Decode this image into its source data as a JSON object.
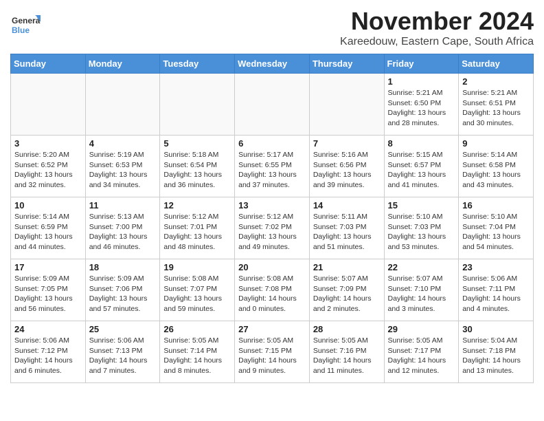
{
  "header": {
    "logo_general": "General",
    "logo_blue": "Blue",
    "month_title": "November 2024",
    "location": "Kareedouw, Eastern Cape, South Africa"
  },
  "weekdays": [
    "Sunday",
    "Monday",
    "Tuesday",
    "Wednesday",
    "Thursday",
    "Friday",
    "Saturday"
  ],
  "weeks": [
    [
      {
        "day": "",
        "info": ""
      },
      {
        "day": "",
        "info": ""
      },
      {
        "day": "",
        "info": ""
      },
      {
        "day": "",
        "info": ""
      },
      {
        "day": "",
        "info": ""
      },
      {
        "day": "1",
        "info": "Sunrise: 5:21 AM\nSunset: 6:50 PM\nDaylight: 13 hours\nand 28 minutes."
      },
      {
        "day": "2",
        "info": "Sunrise: 5:21 AM\nSunset: 6:51 PM\nDaylight: 13 hours\nand 30 minutes."
      }
    ],
    [
      {
        "day": "3",
        "info": "Sunrise: 5:20 AM\nSunset: 6:52 PM\nDaylight: 13 hours\nand 32 minutes."
      },
      {
        "day": "4",
        "info": "Sunrise: 5:19 AM\nSunset: 6:53 PM\nDaylight: 13 hours\nand 34 minutes."
      },
      {
        "day": "5",
        "info": "Sunrise: 5:18 AM\nSunset: 6:54 PM\nDaylight: 13 hours\nand 36 minutes."
      },
      {
        "day": "6",
        "info": "Sunrise: 5:17 AM\nSunset: 6:55 PM\nDaylight: 13 hours\nand 37 minutes."
      },
      {
        "day": "7",
        "info": "Sunrise: 5:16 AM\nSunset: 6:56 PM\nDaylight: 13 hours\nand 39 minutes."
      },
      {
        "day": "8",
        "info": "Sunrise: 5:15 AM\nSunset: 6:57 PM\nDaylight: 13 hours\nand 41 minutes."
      },
      {
        "day": "9",
        "info": "Sunrise: 5:14 AM\nSunset: 6:58 PM\nDaylight: 13 hours\nand 43 minutes."
      }
    ],
    [
      {
        "day": "10",
        "info": "Sunrise: 5:14 AM\nSunset: 6:59 PM\nDaylight: 13 hours\nand 44 minutes."
      },
      {
        "day": "11",
        "info": "Sunrise: 5:13 AM\nSunset: 7:00 PM\nDaylight: 13 hours\nand 46 minutes."
      },
      {
        "day": "12",
        "info": "Sunrise: 5:12 AM\nSunset: 7:01 PM\nDaylight: 13 hours\nand 48 minutes."
      },
      {
        "day": "13",
        "info": "Sunrise: 5:12 AM\nSunset: 7:02 PM\nDaylight: 13 hours\nand 49 minutes."
      },
      {
        "day": "14",
        "info": "Sunrise: 5:11 AM\nSunset: 7:03 PM\nDaylight: 13 hours\nand 51 minutes."
      },
      {
        "day": "15",
        "info": "Sunrise: 5:10 AM\nSunset: 7:03 PM\nDaylight: 13 hours\nand 53 minutes."
      },
      {
        "day": "16",
        "info": "Sunrise: 5:10 AM\nSunset: 7:04 PM\nDaylight: 13 hours\nand 54 minutes."
      }
    ],
    [
      {
        "day": "17",
        "info": "Sunrise: 5:09 AM\nSunset: 7:05 PM\nDaylight: 13 hours\nand 56 minutes."
      },
      {
        "day": "18",
        "info": "Sunrise: 5:09 AM\nSunset: 7:06 PM\nDaylight: 13 hours\nand 57 minutes."
      },
      {
        "day": "19",
        "info": "Sunrise: 5:08 AM\nSunset: 7:07 PM\nDaylight: 13 hours\nand 59 minutes."
      },
      {
        "day": "20",
        "info": "Sunrise: 5:08 AM\nSunset: 7:08 PM\nDaylight: 14 hours\nand 0 minutes."
      },
      {
        "day": "21",
        "info": "Sunrise: 5:07 AM\nSunset: 7:09 PM\nDaylight: 14 hours\nand 2 minutes."
      },
      {
        "day": "22",
        "info": "Sunrise: 5:07 AM\nSunset: 7:10 PM\nDaylight: 14 hours\nand 3 minutes."
      },
      {
        "day": "23",
        "info": "Sunrise: 5:06 AM\nSunset: 7:11 PM\nDaylight: 14 hours\nand 4 minutes."
      }
    ],
    [
      {
        "day": "24",
        "info": "Sunrise: 5:06 AM\nSunset: 7:12 PM\nDaylight: 14 hours\nand 6 minutes."
      },
      {
        "day": "25",
        "info": "Sunrise: 5:06 AM\nSunset: 7:13 PM\nDaylight: 14 hours\nand 7 minutes."
      },
      {
        "day": "26",
        "info": "Sunrise: 5:05 AM\nSunset: 7:14 PM\nDaylight: 14 hours\nand 8 minutes."
      },
      {
        "day": "27",
        "info": "Sunrise: 5:05 AM\nSunset: 7:15 PM\nDaylight: 14 hours\nand 9 minutes."
      },
      {
        "day": "28",
        "info": "Sunrise: 5:05 AM\nSunset: 7:16 PM\nDaylight: 14 hours\nand 11 minutes."
      },
      {
        "day": "29",
        "info": "Sunrise: 5:05 AM\nSunset: 7:17 PM\nDaylight: 14 hours\nand 12 minutes."
      },
      {
        "day": "30",
        "info": "Sunrise: 5:04 AM\nSunset: 7:18 PM\nDaylight: 14 hours\nand 13 minutes."
      }
    ]
  ]
}
